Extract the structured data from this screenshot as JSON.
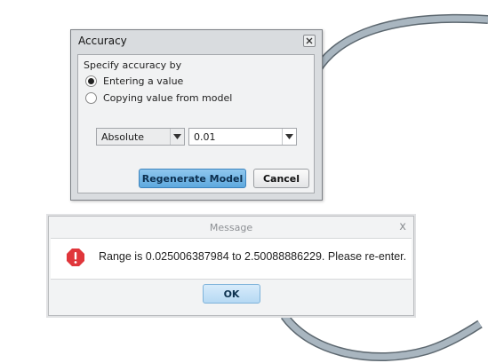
{
  "accuracy_dialog": {
    "title": "Accuracy",
    "group_label": "Specify accuracy by",
    "radio_options": [
      {
        "label": "Entering a value",
        "selected": true
      },
      {
        "label": "Copying value from model",
        "selected": false
      }
    ],
    "mode_select": {
      "value": "Absolute"
    },
    "value_input": {
      "value": "0.01"
    },
    "buttons": {
      "regenerate": "Regenerate Model",
      "cancel": "Cancel"
    }
  },
  "message_dialog": {
    "title": "Message",
    "close_glyph": "x",
    "text": "Range is 0.025006387984 to 2.50088886229. Please re-enter.",
    "ok_label": "OK",
    "icon": "error-icon"
  },
  "colors": {
    "accent": "#5ea9de",
    "error": "#e0363b",
    "model_ring": "#a9b6c0"
  }
}
